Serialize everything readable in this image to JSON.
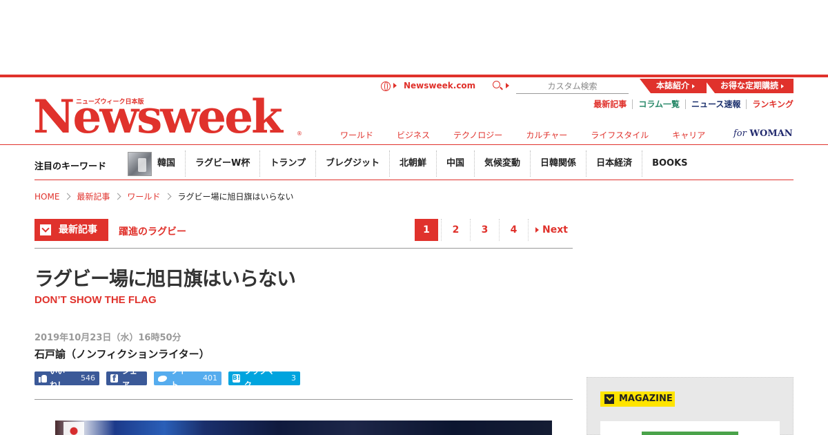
{
  "header": {
    "logo_text": "Newsweek",
    "logo_subtext": "ニューズウィーク日本版",
    "logo_reg": "®",
    "site_link": "Newsweek.com",
    "search_placeholder": "カスタム検索",
    "tab_about": "本誌紹介",
    "tab_subscribe": "お得な定期購読",
    "util_nav": [
      {
        "label": "最新記事",
        "color": "#e0322c"
      },
      {
        "label": "コラム一覧",
        "color": "#2a8a6a"
      },
      {
        "label": "ニュース速報",
        "color": "#1a2f6c"
      },
      {
        "label": "ランキング",
        "color": "#e0322c"
      }
    ],
    "categories": [
      "ワールド",
      "ビジネス",
      "テクノロジー",
      "カルチャー",
      "ライフスタイル",
      "キャリア"
    ],
    "for_woman_prefix": "for",
    "for_woman": "WOMAN"
  },
  "keywords": {
    "label": "注目のキーワード",
    "items": [
      "韓国",
      "ラグビーW杯",
      "トランプ",
      "ブレグジット",
      "北朝鮮",
      "中国",
      "気候変動",
      "日韓関係",
      "日本経済",
      "BOOKS"
    ]
  },
  "breadcrumb": {
    "items": [
      "HOME",
      "最新記事",
      "ワールド"
    ],
    "current": "ラグビー場に旭日旗はいらない"
  },
  "series": {
    "badge": "最新記事",
    "title": "躍進のラグビー"
  },
  "pagination": {
    "pages": [
      "1",
      "2",
      "3",
      "4"
    ],
    "current": "1",
    "next": "Next"
  },
  "article": {
    "title": "ラグビー場に旭日旗はいらない",
    "subtitle": "DON’T SHOW THE FLAG",
    "date": "2019年10月23日（水）16時50分",
    "author": "石戸諭（ノンフィクションライター）"
  },
  "share": {
    "like_label": "いいね！",
    "like_count": "546",
    "fb_share_label": "シェア",
    "tweet_label": "ツイート",
    "tweet_count": "401",
    "bookmark_label": "ブックマーク",
    "bookmark_count": "3"
  },
  "sidebar": {
    "magazine_label": "MAGAZINE"
  },
  "colors": {
    "brand_red": "#e0322c",
    "facebook": "#3b5998",
    "twitter": "#55acee",
    "hatena": "#00a4de",
    "magazine_yellow": "#ffe400"
  }
}
